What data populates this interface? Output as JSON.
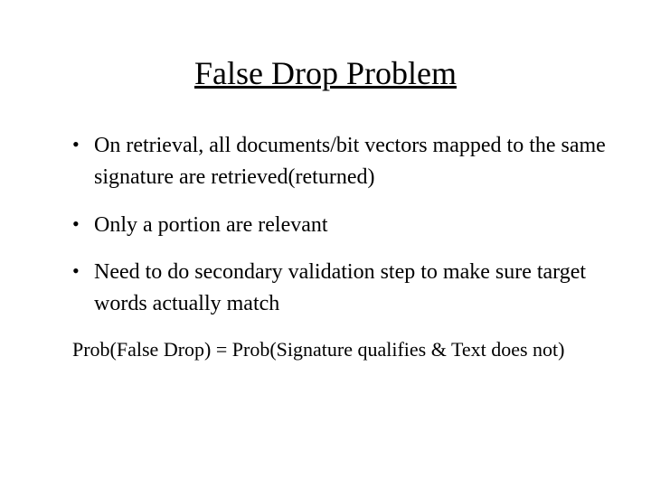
{
  "slide": {
    "title": "False Drop Problem",
    "bullets": [
      "On retrieval, all documents/bit vectors mapped to the same signature are retrieved(returned)",
      "Only a portion are relevant",
      "Need to do secondary validation step to make sure target words actually match"
    ],
    "footer": "Prob(False Drop) = Prob(Signature qualifies & Text does not)"
  }
}
